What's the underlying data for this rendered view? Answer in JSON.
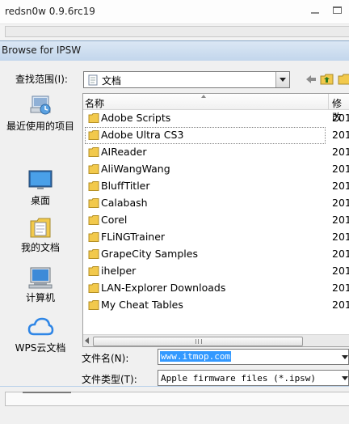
{
  "background_window": {
    "title": "redsn0w 0.9.6rc19"
  },
  "dialog": {
    "title": "Browse for IPSW",
    "look_in_label": "查找范围(I):",
    "look_in_value": "文档"
  },
  "places": [
    {
      "label": "最近使用的项目",
      "icon": "recent-items-icon"
    },
    {
      "label": "桌面",
      "icon": "desktop-icon"
    },
    {
      "label": "我的文档",
      "icon": "my-documents-icon"
    },
    {
      "label": "计算机",
      "icon": "computer-icon"
    },
    {
      "label": "WPS云文档",
      "icon": "cloud-icon"
    }
  ],
  "columns": {
    "name": "名称",
    "modified": "修改"
  },
  "files": [
    {
      "name": "Adobe Scripts",
      "date": "201"
    },
    {
      "name": "Adobe Ultra CS3",
      "date": "201"
    },
    {
      "name": "AIReader",
      "date": "201"
    },
    {
      "name": "AliWangWang",
      "date": "201"
    },
    {
      "name": "BluffTitler",
      "date": "201"
    },
    {
      "name": "Calabash",
      "date": "201"
    },
    {
      "name": "Corel",
      "date": "201"
    },
    {
      "name": "FLiNGTrainer",
      "date": "201"
    },
    {
      "name": "GrapeCity Samples",
      "date": "201"
    },
    {
      "name": "ihelper",
      "date": "201"
    },
    {
      "name": "LAN-Explorer Downloads",
      "date": "201"
    },
    {
      "name": "My Cheat Tables",
      "date": "201"
    }
  ],
  "selected_file_index": 1,
  "file_name": {
    "label": "文件名(N):",
    "value": "www.itmop.com"
  },
  "file_type": {
    "label": "文件类型(T):",
    "value": "Apple firmware files (*.ipsw)"
  },
  "colors": {
    "folder": "#f2c94c",
    "selection": "#3399ff",
    "dialog_frame": "#bcd2ea"
  }
}
